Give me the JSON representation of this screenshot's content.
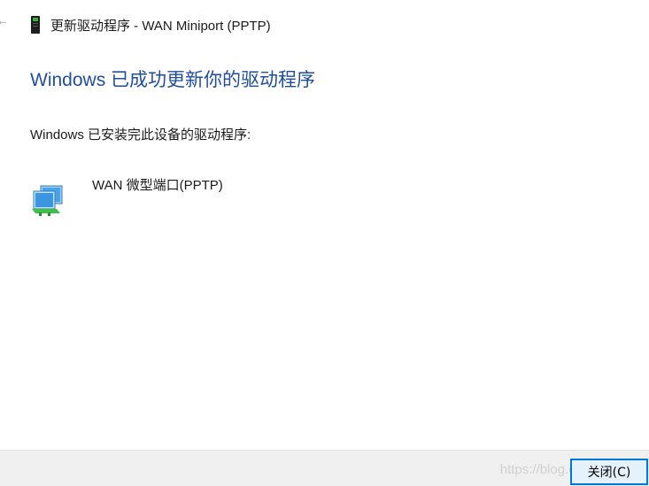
{
  "window": {
    "title": "更新驱动程序 - WAN Miniport (PPTP)"
  },
  "heading": "Windows 已成功更新你的驱动程序",
  "message": "Windows 已安装完此设备的驱动程序:",
  "device": {
    "name": "WAN 微型端口(PPTP)",
    "icon": "network-adapter-icon"
  },
  "footer": {
    "close_label": "关闭(C)",
    "watermark": "https://blog.csdn.net/l  6"
  },
  "colors": {
    "heading": "#1f4e9b",
    "button_border": "#0078d7",
    "footer_bg": "#f0f0f0"
  }
}
